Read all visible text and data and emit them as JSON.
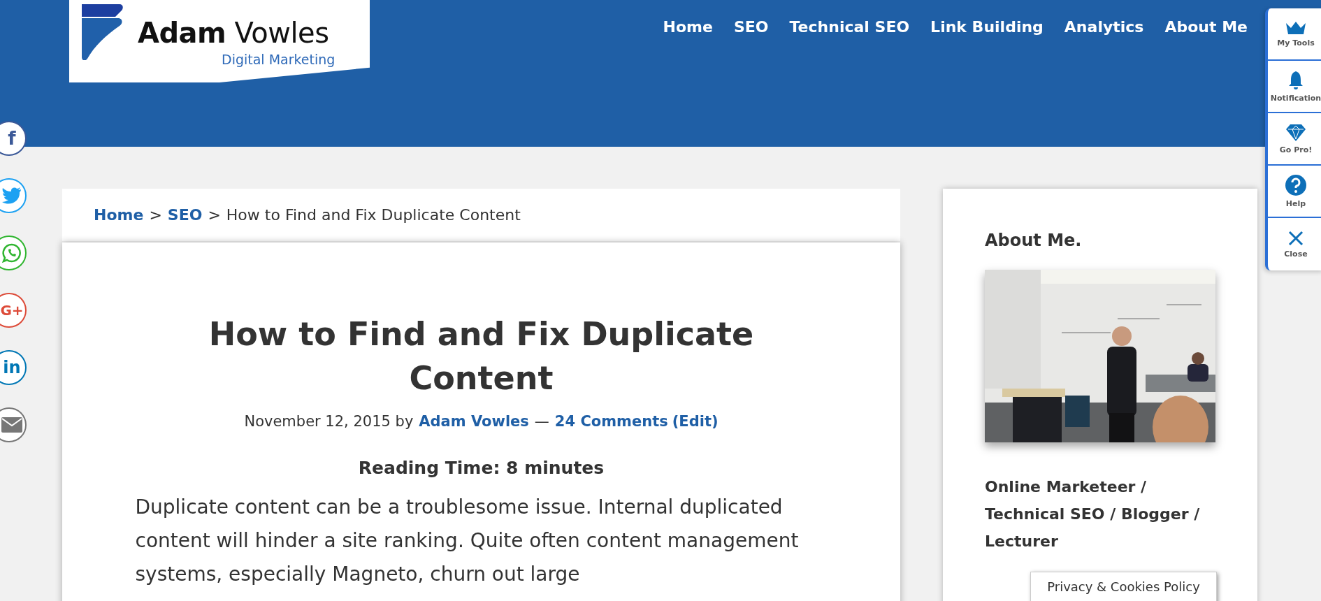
{
  "logo": {
    "name_bold": "Adam",
    "name_light": "Vowles",
    "tagline": "Digital Marketing"
  },
  "nav": [
    {
      "label": "Home"
    },
    {
      "label": "SEO"
    },
    {
      "label": "Technical SEO"
    },
    {
      "label": "Link Building"
    },
    {
      "label": "Analytics"
    },
    {
      "label": "About Me"
    }
  ],
  "social": [
    {
      "kind": "facebook",
      "color": "#3b5998",
      "glyph": "f"
    },
    {
      "kind": "twitter",
      "color": "#1da1f2"
    },
    {
      "kind": "whatsapp",
      "color": "#2fb52f"
    },
    {
      "kind": "googleplus",
      "color": "#dd4b39",
      "glyph": "G+"
    },
    {
      "kind": "linkedin",
      "color": "#0077b5",
      "glyph": "in"
    },
    {
      "kind": "email",
      "color": "#777777"
    }
  ],
  "breadcrumb": [
    {
      "label": "Home",
      "kind": "link"
    },
    {
      "label": ">",
      "kind": "separator"
    },
    {
      "label": "SEO",
      "kind": "link"
    },
    {
      "label": ">",
      "kind": "separator"
    },
    {
      "label": "How to Find and Fix Duplicate Content",
      "kind": "current"
    }
  ],
  "article": {
    "title": "How to Find and Fix Duplicate Content",
    "date_text": "November 12, 2015 by",
    "author": "Adam Vowles",
    "dash": "—",
    "comments": "24 Comments",
    "edit": "(Edit)",
    "reading_time": "Reading Time: 8 minutes",
    "body": "Duplicate content can be a troublesome issue. Internal duplicated content will hinder a site ranking. Quite often content management systems, especially Magneto, churn out large"
  },
  "sidebar": {
    "heading": "About Me.",
    "roles": "Online Marketeer / Technical SEO / Blogger / Lecturer"
  },
  "toolbar": [
    {
      "kind": "crown",
      "label": "My Tools"
    },
    {
      "kind": "bell",
      "label": "Notification"
    },
    {
      "kind": "diamond",
      "label": "Go Pro!"
    },
    {
      "kind": "help",
      "label": "Help"
    },
    {
      "kind": "close",
      "label": "Close"
    }
  ],
  "privacy_button": "Privacy & Cookies Policy"
}
